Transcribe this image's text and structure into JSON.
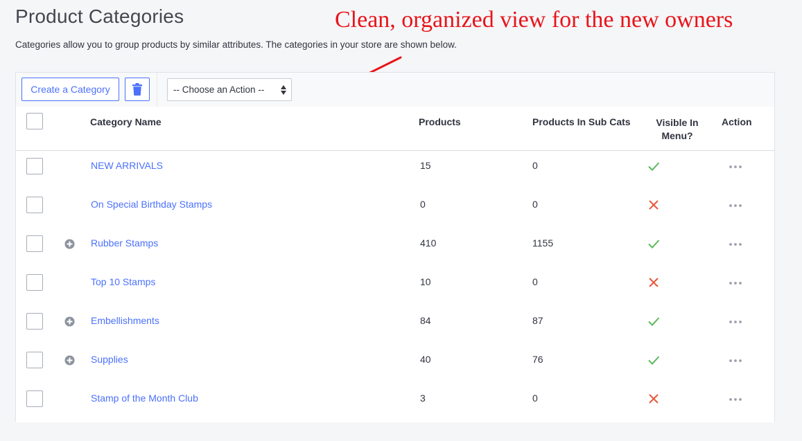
{
  "page": {
    "title": "Product Categories",
    "description": "Categories allow you to group products by similar attributes. The categories in your store are shown below."
  },
  "annotation": {
    "text": "Clean, organized view for the new owners",
    "color": "#e8141a"
  },
  "toolbar": {
    "create_label": "Create a Category",
    "delete_icon": "trash-icon",
    "action_select_value": "-- Choose an Action --"
  },
  "table": {
    "columns": {
      "name": "Category Name",
      "products": "Products",
      "sub_products": "Products In Sub Cats",
      "visible": "Visible In Menu?",
      "action": "Action"
    },
    "rows": [
      {
        "name": "NEW ARRIVALS",
        "products": "15",
        "sub_products": "0",
        "visible": true,
        "has_children": false
      },
      {
        "name": "On Special Birthday Stamps",
        "products": "0",
        "sub_products": "0",
        "visible": false,
        "has_children": false
      },
      {
        "name": "Rubber Stamps",
        "products": "410",
        "sub_products": "1155",
        "visible": true,
        "has_children": true
      },
      {
        "name": "Top 10 Stamps",
        "products": "10",
        "sub_products": "0",
        "visible": false,
        "has_children": false
      },
      {
        "name": "Embellishments",
        "products": "84",
        "sub_products": "87",
        "visible": true,
        "has_children": true
      },
      {
        "name": "Supplies",
        "products": "40",
        "sub_products": "76",
        "visible": true,
        "has_children": true
      },
      {
        "name": "Stamp of the Month Club",
        "products": "3",
        "sub_products": "0",
        "visible": false,
        "has_children": false
      }
    ]
  },
  "colors": {
    "link": "#4b71fc",
    "check": "#5cb85c",
    "cross": "#e8593b",
    "annotation": "#e8141a"
  }
}
